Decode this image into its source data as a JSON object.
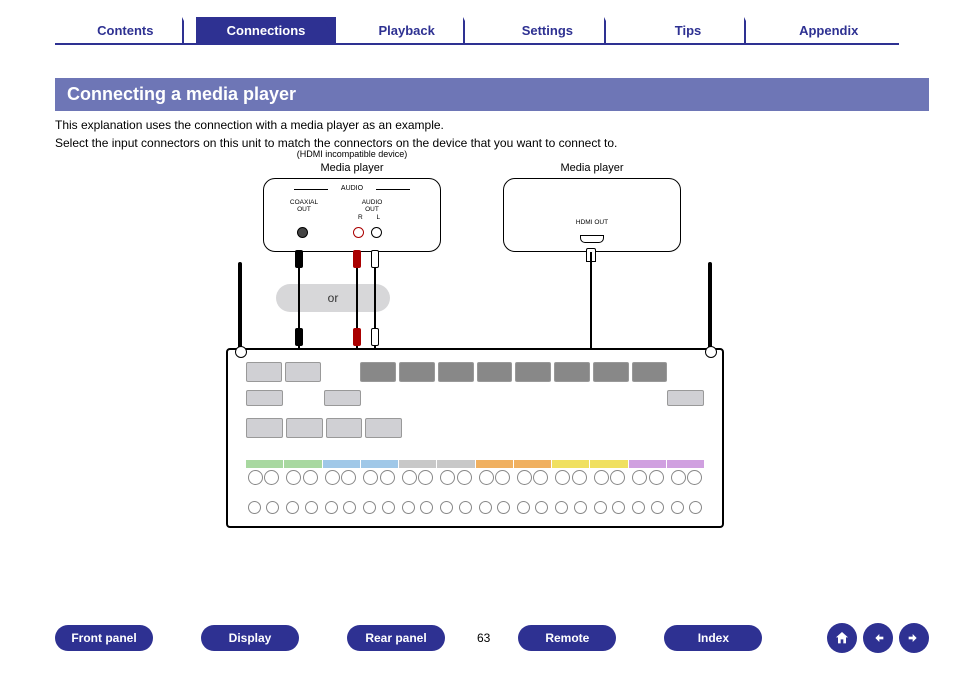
{
  "top_tabs": {
    "contents": "Contents",
    "connections": "Connections",
    "playback": "Playback",
    "settings": "Settings",
    "tips": "Tips",
    "appendix": "Appendix",
    "active": "connections"
  },
  "title": "Connecting a media player",
  "body_line1": "This explanation uses the connection with a media player as an example.",
  "body_line2": "Select the input connectors on this unit to match the connectors on the device that you want to connect to.",
  "diagram": {
    "left_box": {
      "sublabel": "(HDMI incompatible device)",
      "label": "Media player",
      "audio_header": "AUDIO",
      "coaxial": "COAXIAL\nOUT",
      "audio_out": "AUDIO\nOUT",
      "rl": "R  L"
    },
    "right_box": {
      "label": "Media player",
      "hdmi": "HDMI\nOUT"
    },
    "or_label": "or"
  },
  "bottom": {
    "front_panel": "Front panel",
    "display": "Display",
    "rear_panel": "Rear panel",
    "remote": "Remote",
    "index": "Index",
    "page": "63"
  }
}
